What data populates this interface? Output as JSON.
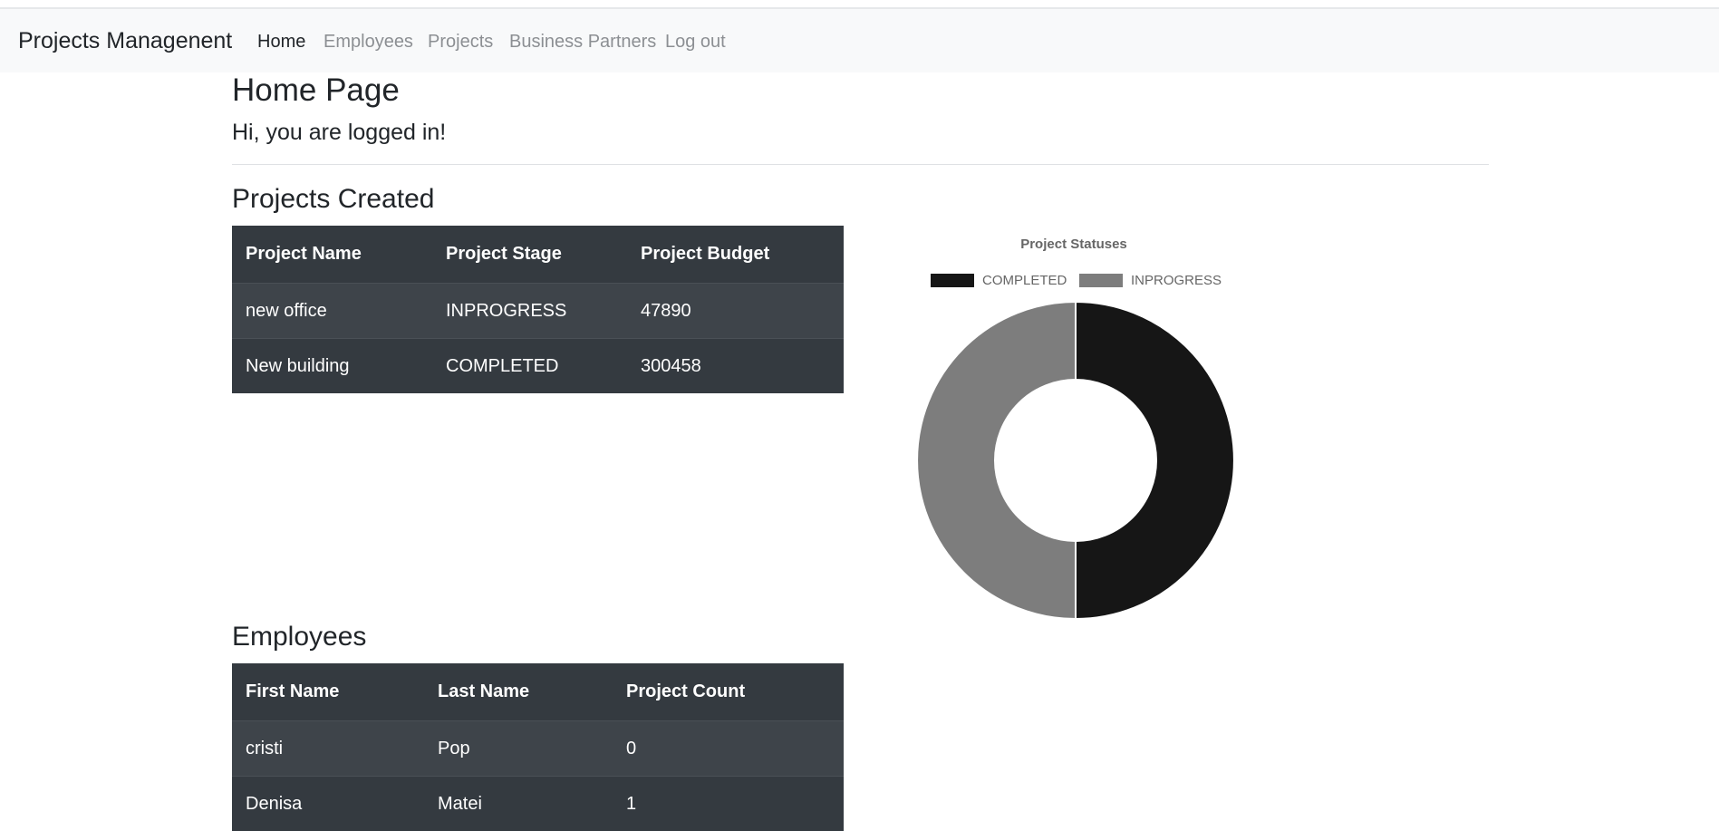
{
  "nav": {
    "brand": "Projects Managenent",
    "links": [
      {
        "label": "Home",
        "active": true
      },
      {
        "label": "Employees",
        "active": false
      },
      {
        "label": "Projects",
        "active": false
      },
      {
        "label": "Business Partners",
        "active": false
      },
      {
        "label": "Log out",
        "active": false
      }
    ]
  },
  "page": {
    "title": "Home Page",
    "greeting": "Hi, you are logged in!"
  },
  "projects": {
    "heading": "Projects Created",
    "columns": [
      "Project Name",
      "Project Stage",
      "Project Budget"
    ],
    "rows": [
      [
        "new office",
        "INPROGRESS",
        "47890"
      ],
      [
        "New building",
        "COMPLETED",
        "300458"
      ]
    ]
  },
  "employees": {
    "heading": "Employees",
    "columns": [
      "First Name",
      "Last Name",
      "Project Count"
    ],
    "rows": [
      [
        "cristi",
        "Pop",
        "0"
      ],
      [
        "Denisa",
        "Matei",
        "1"
      ]
    ]
  },
  "colors": {
    "navbar_bg": "#f8f9fa",
    "table_bg": "#343a40",
    "completed": "#161616",
    "inprogress": "#7d7d7d"
  },
  "chart_data": {
    "type": "pie",
    "variant": "doughnut",
    "title": "Project Statuses",
    "labels": [
      "COMPLETED",
      "INPROGRESS"
    ],
    "values": [
      1,
      1
    ],
    "colors": [
      "#161616",
      "#7d7d7d"
    ],
    "legend": "top"
  }
}
